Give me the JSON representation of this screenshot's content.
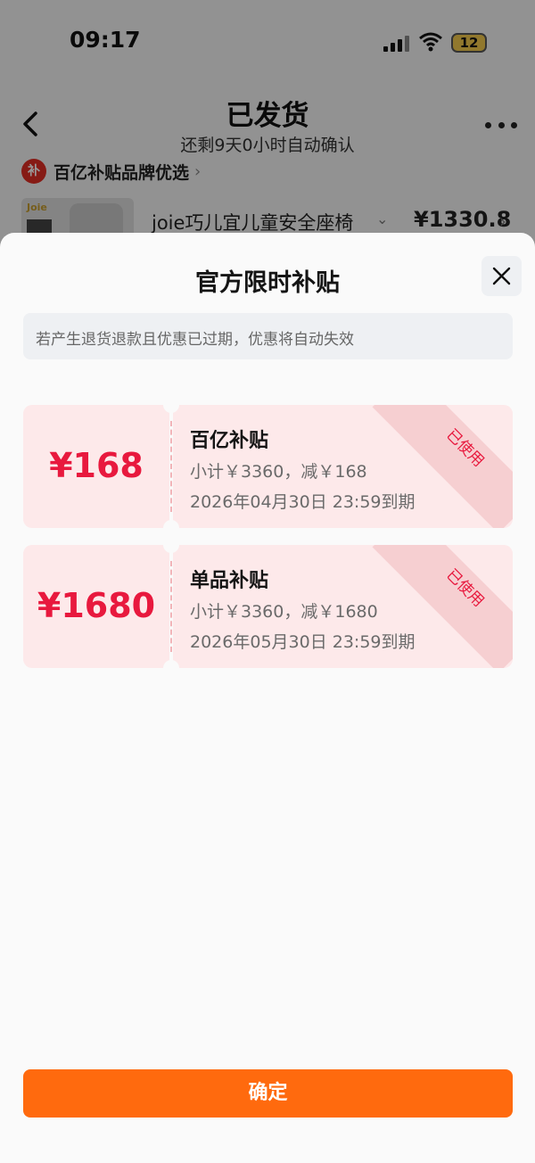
{
  "status_bar": {
    "time": "09:17",
    "battery": "12"
  },
  "nav": {
    "title": "已发货",
    "subtitle": "还剩9天0小时自动确认"
  },
  "brand": {
    "label": "百亿补贴品牌优选",
    "logo_text": "补"
  },
  "product": {
    "brand_logo": "Joie",
    "name": "joie巧儿宜儿童安全座椅",
    "price": "¥1330.8"
  },
  "sheet": {
    "title": "官方限时补贴",
    "notice": "若产生退货退款且优惠已过期，优惠将自动失效",
    "coupons": [
      {
        "amount": "¥168",
        "name": "百亿补贴",
        "subtotal": "小计￥3360，减￥168",
        "expiry": "2026年04月30日 23:59到期",
        "status": "已使用"
      },
      {
        "amount": "¥1680",
        "name": "单品补贴",
        "subtotal": "小计￥3360，减￥1680",
        "expiry": "2026年05月30日 23:59到期",
        "status": "已使用"
      }
    ],
    "confirm_label": "确定"
  },
  "colors": {
    "accent": "#ff6a0e",
    "coupon_red": "#e8193e",
    "coupon_bg": "#fde9ea"
  }
}
